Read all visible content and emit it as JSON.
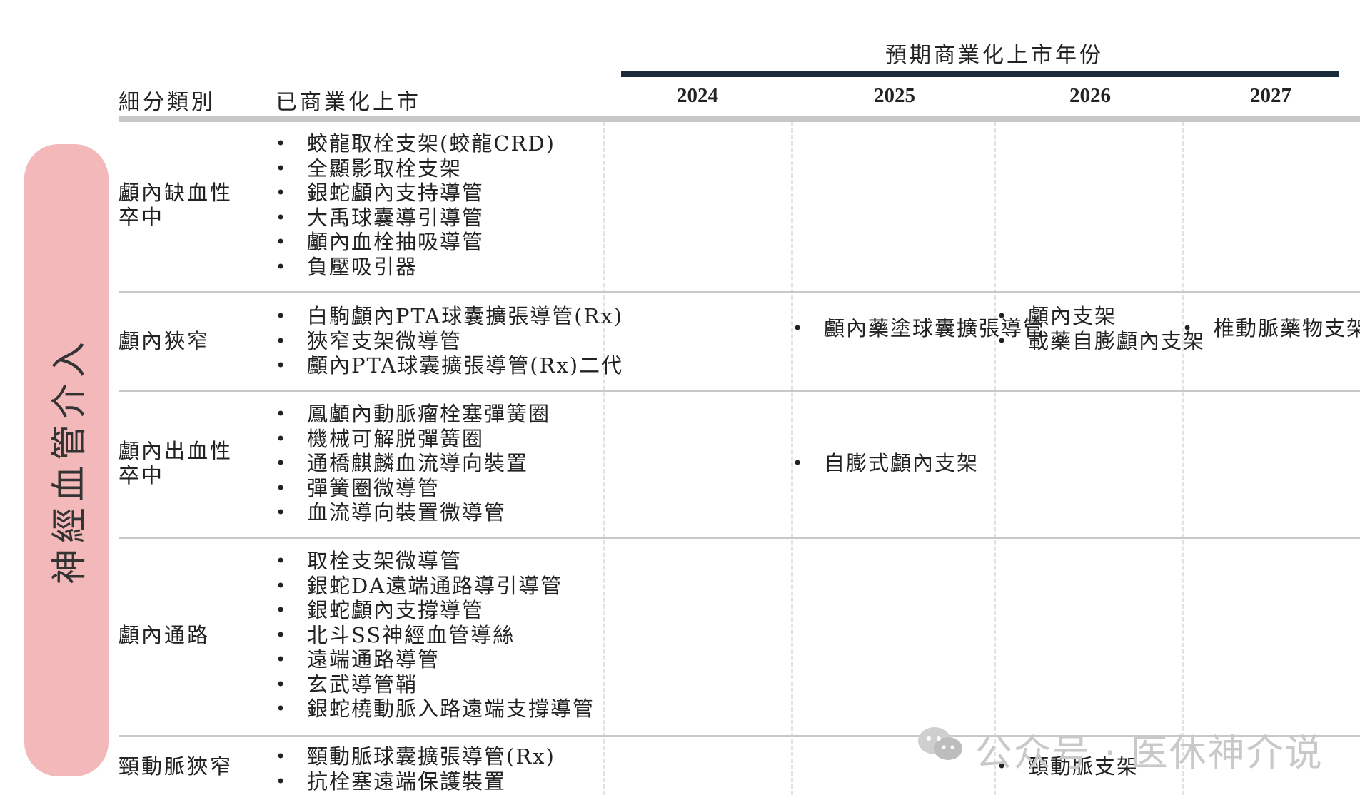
{
  "header": {
    "category_label": "細分類別",
    "marketed_label": "已商業化上市",
    "expected_label": "預期商業化上市年份",
    "years": [
      "2024",
      "2025",
      "2026",
      "2027"
    ]
  },
  "side_label": "神經血管介入",
  "rows": [
    {
      "category": "顱內缺血性卒中",
      "marketed": [
        "蛟龍取栓支架(蛟龍CRD)",
        "全顯影取栓支架",
        "銀蛇顱內支持導管",
        "大禹球囊導引導管",
        "顱內血栓抽吸導管",
        "負壓吸引器"
      ],
      "y2024": [],
      "y2025": [],
      "y2026": [],
      "y2027": []
    },
    {
      "category": "顱內狹窄",
      "marketed": [
        "白駒顱內PTA球囊擴張導管(Rx)",
        "狹窄支架微導管",
        "顱內PTA球囊擴張導管(Rx)二代"
      ],
      "y2024": [],
      "y2025": [
        "顱內藥塗球囊擴張導管"
      ],
      "y2026": [
        "顱內支架",
        "載藥自膨顱內支架"
      ],
      "y2027": [
        "椎動脈藥物支架"
      ]
    },
    {
      "category": "顱內出血性卒中",
      "marketed": [
        "鳳顱內動脈瘤栓塞彈簧圈",
        "機械可解脱彈簧圈",
        "通橋麒麟血流導向裝置",
        "彈簧圈微導管",
        "血流導向裝置微導管"
      ],
      "y2024": [],
      "y2025": [
        "自膨式顱內支架"
      ],
      "y2026": [],
      "y2027": []
    },
    {
      "category": "顱內通路",
      "marketed": [
        "取栓支架微導管",
        "銀蛇DA遠端通路導引導管",
        "銀蛇顱內支撐導管",
        "北斗SS神經血管導絲",
        "遠端通路導管",
        "玄武導管鞘",
        "銀蛇橈動脈入路遠端支撐導管"
      ],
      "y2024": [],
      "y2025": [],
      "y2026": [],
      "y2027": []
    },
    {
      "category": "頸動脈狹窄",
      "marketed": [
        "頸動脈球囊擴張導管(Rx)",
        "抗栓塞遠端保護裝置"
      ],
      "y2024": [],
      "y2025": [],
      "y2026": [
        "頸動脈支架"
      ],
      "y2027": []
    }
  ],
  "watermark": "公众号 · 医休神介说"
}
